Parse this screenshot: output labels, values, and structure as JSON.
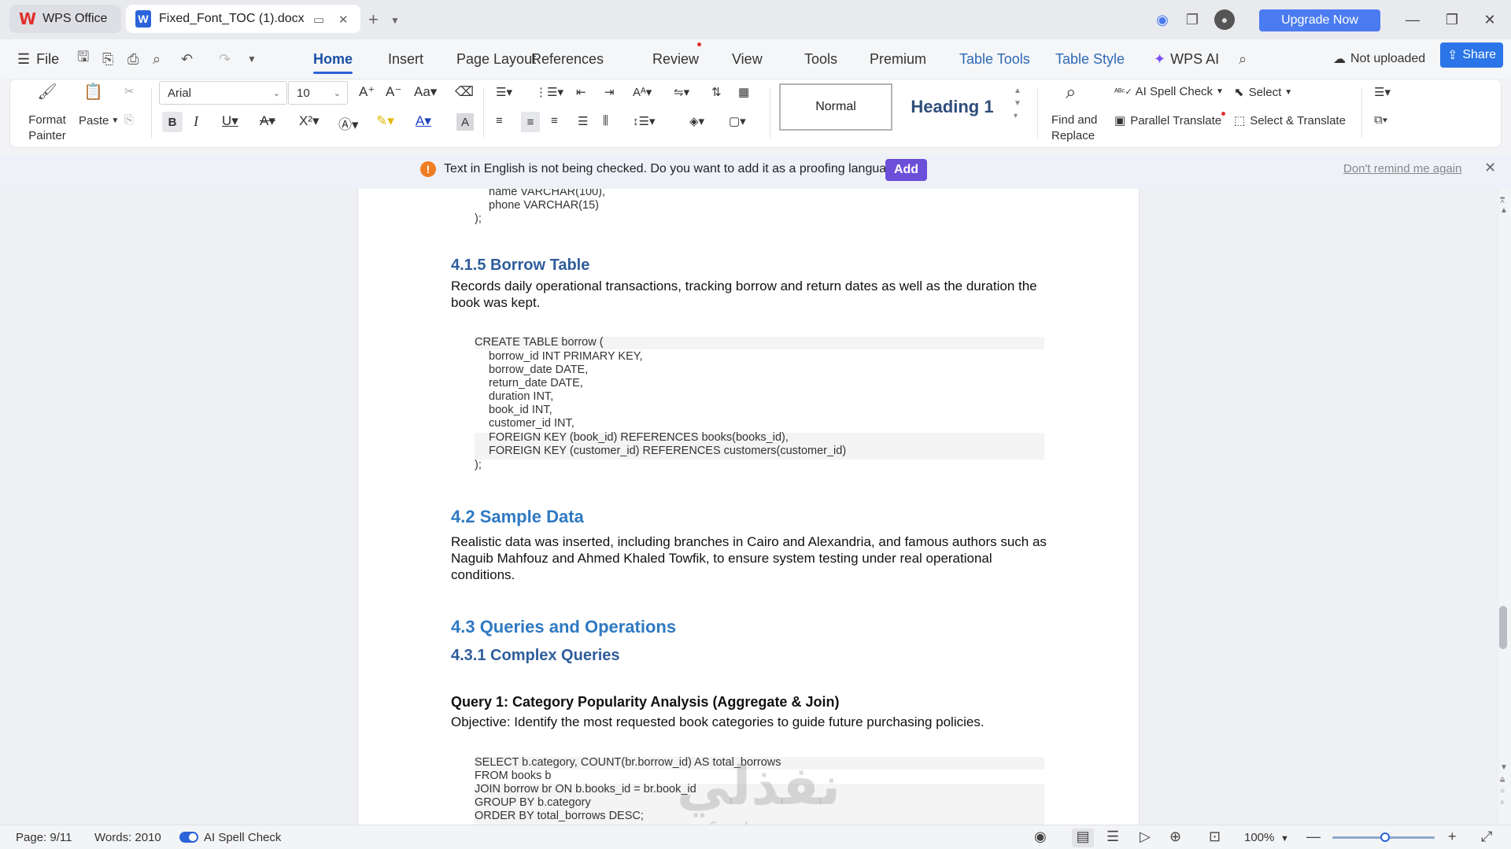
{
  "titlebar": {
    "app_tab": "WPS Office",
    "doc_tab": "Fixed_Font_TOC (1).docx",
    "upgrade": "Upgrade Now"
  },
  "menu": {
    "file": "File",
    "tabs": [
      "Home",
      "Insert",
      "Page Layout",
      "References",
      "Review",
      "View",
      "Tools",
      "Premium",
      "Table Tools",
      "Table Style",
      "WPS AI"
    ],
    "not_uploaded": "Not uploaded",
    "share": "Share"
  },
  "ribbon": {
    "format_painter": "Format Painter",
    "format_painter_l1": "Format",
    "format_painter_l2": "Painter",
    "paste": "Paste",
    "font_name": "Arial",
    "font_size": "10",
    "style_normal": "Normal",
    "style_heading1": "Heading 1",
    "find_l1": "Find and",
    "find_l2": "Replace",
    "ai_spell": "AI Spell Check",
    "select": "Select",
    "parallel_translate": "Parallel Translate",
    "select_translate": "Select & Translate"
  },
  "notification": {
    "text": "Text in English is not being checked. Do you want to add it as a proofing language?",
    "add": "Add",
    "dont_remind": "Don't remind me again"
  },
  "document": {
    "code_customers_tail": [
      "name VARCHAR(100),",
      "phone VARCHAR(15)",
      ");"
    ],
    "h_borrow": "4.1.5 Borrow Table",
    "p_borrow": "Records daily operational transactions, tracking borrow and return dates as well as the duration the book was kept.",
    "code_borrow": [
      "CREATE TABLE borrow (",
      "borrow_id INT PRIMARY KEY,",
      "borrow_date DATE,",
      "return_date DATE,",
      "duration INT,",
      "book_id INT,",
      "customer_id INT,",
      "FOREIGN KEY (book_id) REFERENCES books(books_id),",
      "FOREIGN KEY (customer_id) REFERENCES customers(customer_id)",
      ");"
    ],
    "h_sample": "4.2 Sample Data",
    "p_sample": "Realistic data was inserted, including branches in Cairo and Alexandria, and famous authors such as Naguib Mahfouz and Ahmed Khaled Towfik, to ensure system testing under real operational conditions.",
    "h_queries": "4.3 Queries and Operations",
    "h_complex": "4.3.1 Complex Queries",
    "q1_title": "Query 1: Category Popularity Analysis (Aggregate & Join)",
    "q1_objective": "Objective: Identify the most requested book categories to guide future purchasing policies.",
    "code_q1": [
      "SELECT b.category, COUNT(br.borrow_id) AS total_borrows",
      "FROM books b",
      "JOIN borrow br ON b.books_id = br.book_id",
      "GROUP BY b.category",
      "ORDER BY total_borrows DESC;"
    ],
    "watermark": "نفذلي",
    "watermark_sub": "nafezly.com"
  },
  "status": {
    "page": "Page: 9/11",
    "words": "Words: 2010",
    "spell": "AI Spell Check",
    "zoom": "100%"
  }
}
